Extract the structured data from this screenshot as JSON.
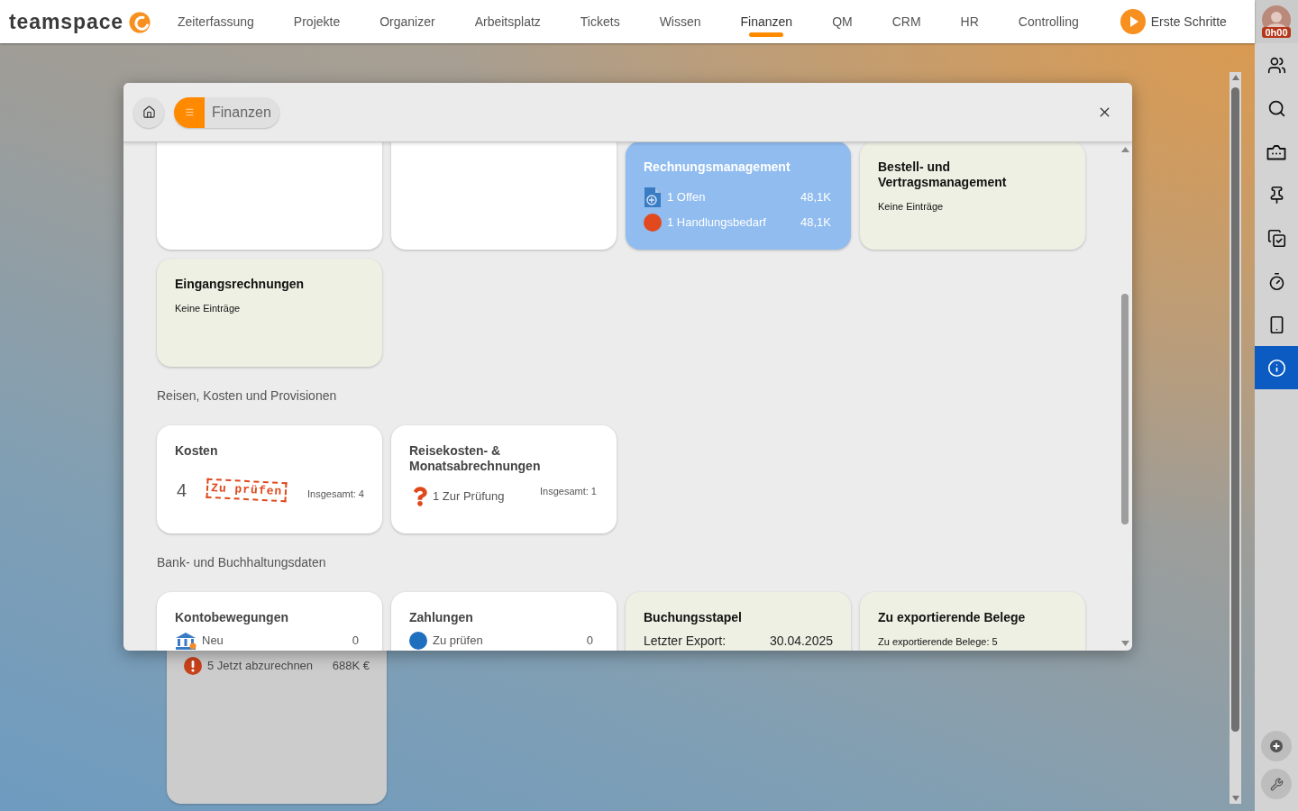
{
  "app": {
    "logo": "teamspace"
  },
  "nav": {
    "items": [
      {
        "label": "Zeiterfassung",
        "selected": false
      },
      {
        "label": "Projekte",
        "selected": false
      },
      {
        "label": "Organizer",
        "selected": false
      },
      {
        "label": "Arbeitsplatz",
        "selected": false
      },
      {
        "label": "Tickets",
        "selected": false
      },
      {
        "label": "Wissen",
        "selected": false
      },
      {
        "label": "Finanzen",
        "selected": true
      },
      {
        "label": "QM",
        "selected": false
      },
      {
        "label": "CRM",
        "selected": false
      },
      {
        "label": "HR",
        "selected": false
      },
      {
        "label": "Controlling",
        "selected": false
      }
    ],
    "guide": "Erste Schritte"
  },
  "user": {
    "timer": "0h00"
  },
  "sidebar": {
    "items": [
      {
        "selected": false
      },
      {
        "selected": false
      },
      {
        "selected": false
      },
      {
        "selected": false
      },
      {
        "selected": false
      },
      {
        "selected": false
      },
      {
        "selected": false
      },
      {
        "selected": true
      }
    ]
  },
  "dashboard_tile": {
    "rows": [
      {
        "kind": "alert",
        "label": "5 Jetzt abzurechnen",
        "value": "688K €"
      }
    ]
  },
  "modal": {
    "breadcrumb": "Finanzen",
    "sections": [
      {
        "tiles": [
          {
            "kind": "blank"
          },
          {
            "kind": "blank"
          },
          {
            "kind": "highlight",
            "title": "Rechnungsmanagement",
            "rows": [
              {
                "kind": "document",
                "label": "1 Offen",
                "value": "48,1K"
              },
              {
                "kind": "dot",
                "color": "#e2491e",
                "label": "1 Handlungsbedarf",
                "value": "48,1K"
              }
            ]
          },
          {
            "kind": "note",
            "title": "Bestell- und Vertragsmanagement",
            "note": "Keine Einträge"
          },
          {
            "kind": "note",
            "title": "Eingangsrechnungen",
            "note": "Keine Einträge"
          }
        ]
      },
      {
        "heading": "Reisen, Kosten und Provisionen",
        "tiles": [
          {
            "kind": "stamp",
            "title": "Kosten",
            "count": "4",
            "stamp": "Zu prüfen",
            "total": "Insgesamt: 4"
          },
          {
            "kind": "review",
            "title": "Reisekosten- & Monatsabrechnungen",
            "rows": [
              {
                "kind": "question",
                "label": "1 Zur Prüfung"
              }
            ],
            "total": "Insgesamt: 1"
          }
        ]
      },
      {
        "heading": "Bank- und Buchhaltungsdaten",
        "tiles": [
          {
            "kind": "list",
            "title": "Kontobewegungen",
            "rows": [
              {
                "kind": "bank",
                "label": "Neu",
                "value": "0"
              }
            ]
          },
          {
            "kind": "list",
            "title": "Zahlungen",
            "rows": [
              {
                "kind": "dot",
                "color": "#1f6fbf",
                "label": "Zu prüfen",
                "value": "0"
              }
            ]
          },
          {
            "kind": "export",
            "title": "Buchungsstapel",
            "rows": [
              {
                "kind": "plain",
                "label": "Letzter Export:",
                "value": "30.04.2025"
              }
            ]
          },
          {
            "kind": "note",
            "title": "Zu exportierende Belege",
            "note": "Zu exportierende Belege: 5"
          }
        ]
      }
    ]
  }
}
